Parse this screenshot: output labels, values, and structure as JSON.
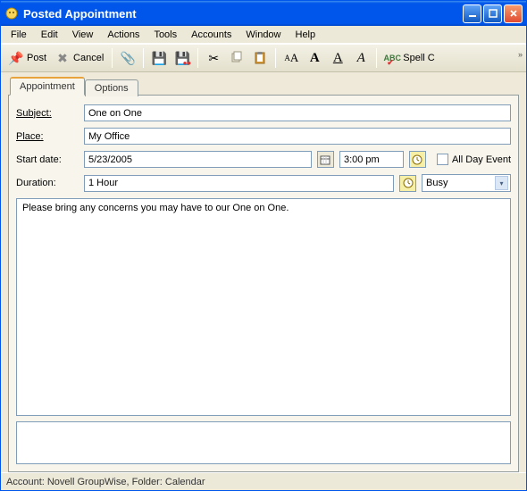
{
  "window": {
    "title": "Posted Appointment"
  },
  "menu": {
    "file": "File",
    "edit": "Edit",
    "view": "View",
    "actions": "Actions",
    "tools": "Tools",
    "accounts": "Accounts",
    "window": "Window",
    "help": "Help"
  },
  "toolbar": {
    "post": "Post",
    "cancel": "Cancel",
    "spellcheck": "Spell C"
  },
  "tabs": {
    "appointment": "Appointment",
    "options": "Options"
  },
  "fields": {
    "subject_label": "Subject:",
    "subject_value": "One on One",
    "place_label": "Place:",
    "place_value": "My Office",
    "start_date_label": "Start date:",
    "start_date_value": "5/23/2005",
    "start_time_value": "3:00 pm",
    "all_day_label": "All Day Event",
    "duration_label": "Duration:",
    "duration_value": "1 Hour",
    "status_value": "Busy"
  },
  "body": {
    "text": "Please bring any concerns you may have to our One on One."
  },
  "status": {
    "text": "Account: Novell GroupWise,  Folder: Calendar"
  },
  "font_buttons": {
    "a1": "A",
    "a2": "A",
    "a3": "A",
    "a4": "A"
  }
}
